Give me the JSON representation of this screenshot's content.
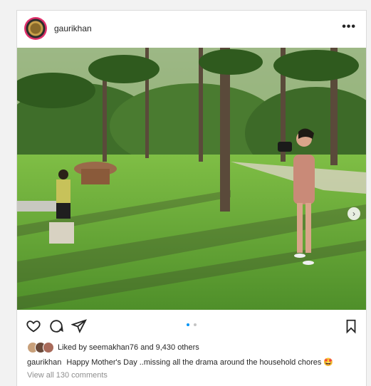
{
  "post": {
    "username": "gaurikhan",
    "more_label": "•••",
    "next_arrow": "›",
    "likes_prefix": "Liked by",
    "liked_by_user": "seemakhan76",
    "likes_suffix": "and 9,430 others",
    "caption_user": "gaurikhan",
    "caption_text": "Happy Mother's Day ..missing all the drama around the household chores",
    "caption_emoji": "🤩",
    "view_comments": "View all 130 comments",
    "carousel_count": 2,
    "carousel_active": 1
  },
  "icons": {
    "like": "heart-icon",
    "comment": "comment-icon",
    "share": "paper-plane-icon",
    "save": "bookmark-icon"
  },
  "colors": {
    "accent": "#0095f6",
    "text": "#262626",
    "muted": "#8e8e8e",
    "border": "#dbdbdb"
  }
}
